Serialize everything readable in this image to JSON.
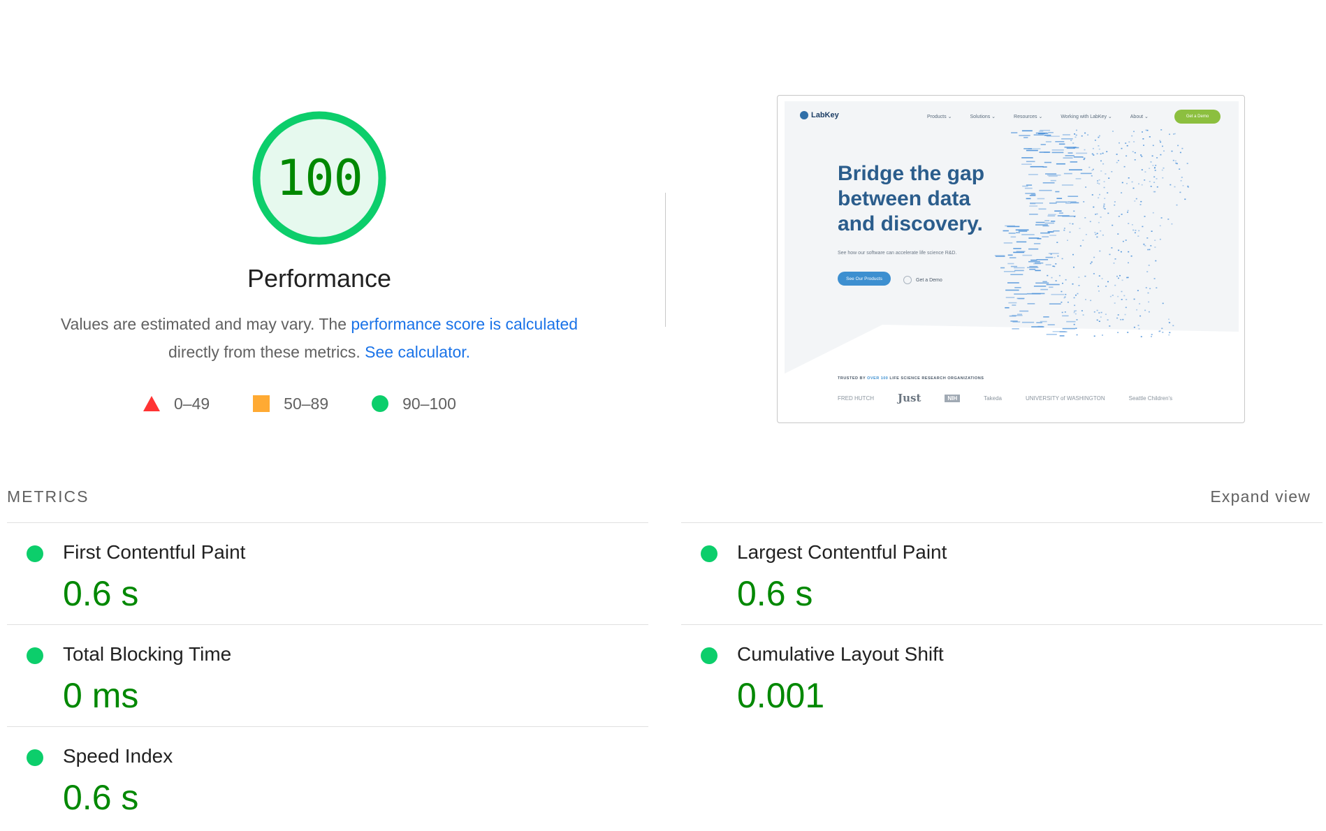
{
  "gauge": {
    "score": "100",
    "score_fraction": 1.0,
    "title": "Performance",
    "colors": {
      "ring": "#0cce6b",
      "fill": "#e6f9ee",
      "text": "#008800"
    }
  },
  "description": {
    "text1": "Values are estimated and may vary. The",
    "link1": "performance score is calculated",
    "text2": "directly from these metrics.",
    "link2": "See calculator."
  },
  "legend": {
    "items": [
      {
        "label": "0–49",
        "shape": "triangle",
        "color": "#ff3333"
      },
      {
        "label": "50–89",
        "shape": "square",
        "color": "#ffaa33"
      },
      {
        "label": "90–100",
        "shape": "circle",
        "color": "#0cce6b"
      }
    ]
  },
  "thumbnail": {
    "logo": "LabKey",
    "menu": [
      "Products ⌄",
      "Solutions ⌄",
      "Resources ⌄",
      "Working with LabKey ⌄",
      "About ⌄"
    ],
    "cta": "Get a Demo",
    "hero_line1": "Bridge the gap",
    "hero_line2": "between data",
    "hero_line3": "and discovery.",
    "subtext": "See how our software can accelerate life science R&D.",
    "primary_button": "See Our Products",
    "secondary_link": "Get a Demo",
    "trusted_prefix": "TRUSTED BY",
    "trusted_highlight": "OVER 100",
    "trusted_suffix": "LIFE SCIENCE RESEARCH ORGANIZATIONS",
    "logos": [
      "FRED HUTCH",
      "Just",
      "NIH",
      "Takeda",
      "UNIVERSITY of WASHINGTON",
      "Seattle Children's"
    ]
  },
  "metrics": {
    "header": "METRICS",
    "expand_label": "Expand view",
    "items": [
      {
        "name": "First Contentful Paint",
        "value": "0.6 s"
      },
      {
        "name": "Largest Contentful Paint",
        "value": "0.6 s"
      },
      {
        "name": "Total Blocking Time",
        "value": "0 ms"
      },
      {
        "name": "Cumulative Layout Shift",
        "value": "0.001"
      },
      {
        "name": "Speed Index",
        "value": "0.6 s"
      }
    ]
  }
}
